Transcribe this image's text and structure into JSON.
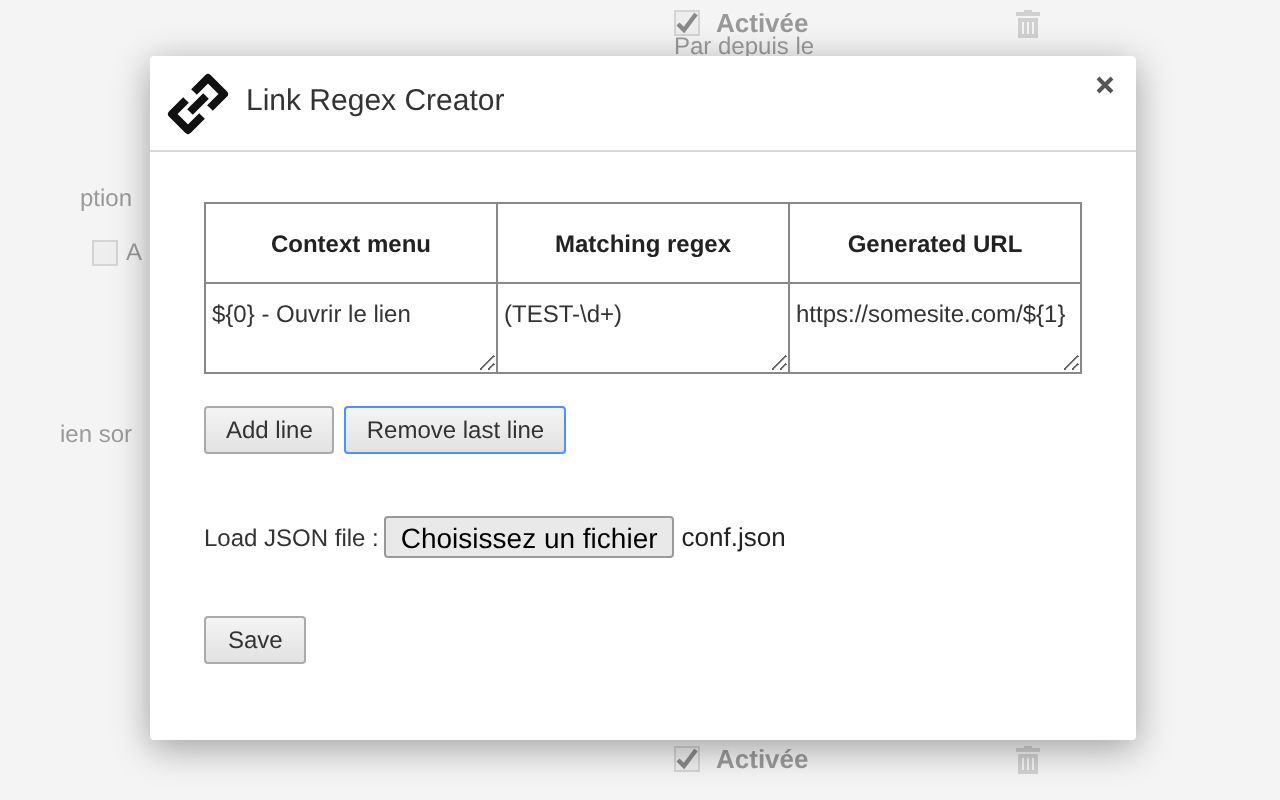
{
  "background": {
    "top_toggle": {
      "label": "Activée",
      "checked": true
    },
    "top_note": "Par depuis le",
    "left_texts": [
      "ption",
      "ien sor"
    ],
    "left_toggle": {
      "label": "A",
      "checked": false
    },
    "bottom_toggle": {
      "label": "Activée",
      "checked": true
    }
  },
  "dialog": {
    "title": "Link Regex Creator",
    "table": {
      "columns": [
        "Context menu",
        "Matching regex",
        "Generated URL"
      ],
      "rows": [
        [
          "${0} - Ouvrir le lien",
          "(TEST-\\d+)",
          "https://somesite.com/${1}"
        ]
      ]
    },
    "buttons": [
      {
        "label": "Add line",
        "focused": false
      },
      {
        "label": "Remove last line",
        "focused": true
      }
    ],
    "file": {
      "label": "Load JSON file :",
      "button": "Choisissez un fichier",
      "filename": "conf.json"
    },
    "save": "Save"
  }
}
